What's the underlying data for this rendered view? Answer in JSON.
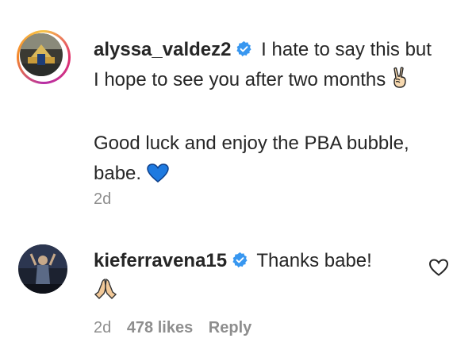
{
  "comments": [
    {
      "username": "alyssa_valdez2",
      "verified": true,
      "text_line1": "I hate to say this but",
      "text_line2": "I hope to see you after two months",
      "paragraph2_line1": "Good luck and enjoy the PBA bubble,",
      "paragraph2_line2": "babe.",
      "timestamp": "2d",
      "emoji_icons": [
        "victory-hand-icon",
        "blue-heart-icon"
      ]
    },
    {
      "username": "kieferravena15",
      "verified": true,
      "text": "Thanks babe!",
      "timestamp": "2d",
      "likes": "478 likes",
      "reply_label": "Reply",
      "emoji_icons": [
        "folded-hands-icon"
      ]
    }
  ],
  "colors": {
    "verified_blue": "#3897f0",
    "muted": "#8e8e8e",
    "text": "#262626"
  }
}
